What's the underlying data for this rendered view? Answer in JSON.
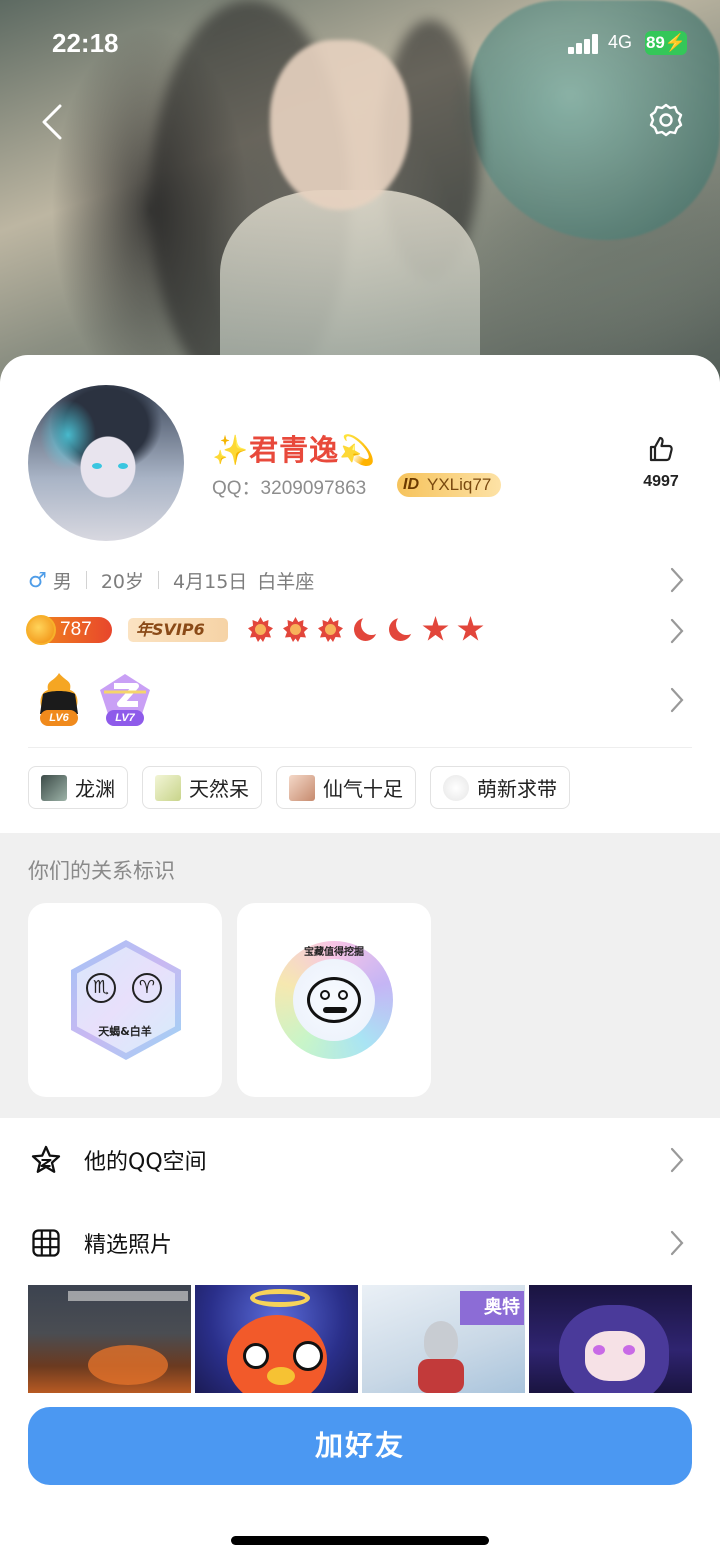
{
  "status_bar": {
    "time": "22:18",
    "network": "4G",
    "battery": "89"
  },
  "profile": {
    "nickname": "✨君青逸💫",
    "qq_label": "QQ：3209097863",
    "id_mark": "ID",
    "id_value": "YXLiq77",
    "likes": "4997"
  },
  "info": {
    "gender_symbol": "♂",
    "gender": "男",
    "age": "20岁",
    "birthday": "4月15日",
    "constellation": "白羊座"
  },
  "vip": {
    "coins": "787",
    "svip": "年SVIP6"
  },
  "medals": [
    "LV6",
    "LV7"
  ],
  "tags": [
    "龙渊",
    "天然呆",
    "仙气十足",
    "萌新求带"
  ],
  "relationship": {
    "title": "你们的关系标识",
    "badge1_text": "天蝎&白羊",
    "badge1_sign1": "♏",
    "badge1_sign2": "♈",
    "badge2_text": "宝藏值得挖掘"
  },
  "menu": {
    "qzone": "他的QQ空间",
    "photos": "精选照片"
  },
  "photo_overlay_text": "奥特",
  "add_friend": "加好友",
  "colors": {
    "accent": "#4b98f2",
    "name": "#e8493b",
    "level": "#e2463b"
  },
  "icons": [
    "back-icon",
    "gear-icon",
    "thumbs-up-icon",
    "chevron-right-icon",
    "star-outline-icon",
    "grid-icon"
  ]
}
